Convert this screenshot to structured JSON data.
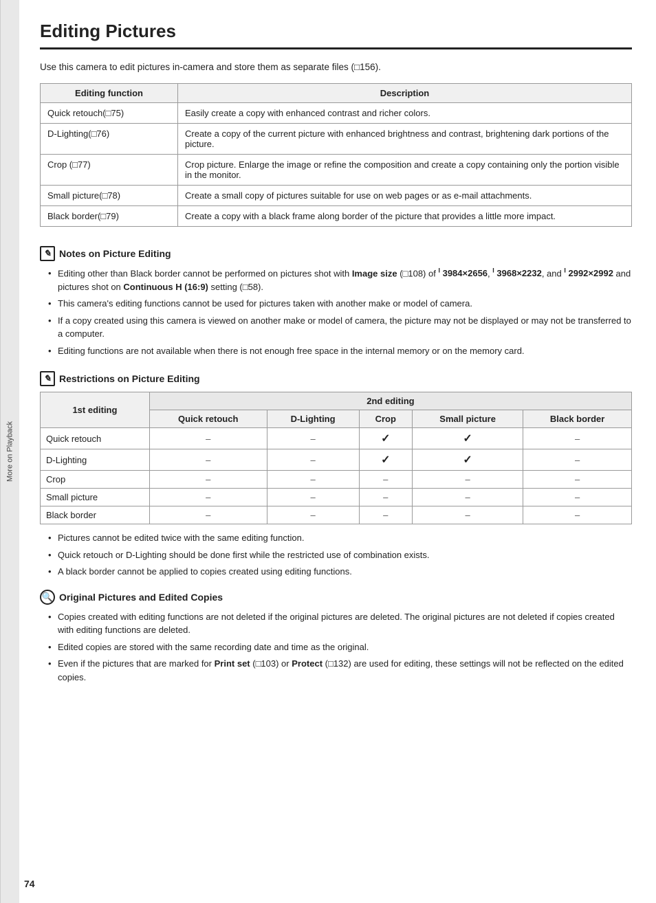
{
  "sidebar": {
    "label": "More on Playback"
  },
  "page": {
    "title": "Editing Pictures",
    "intro": "Use this camera to edit pictures in-camera and store them as separate files (◻156).",
    "page_number": "74"
  },
  "editing_table": {
    "headers": [
      "Editing function",
      "Description"
    ],
    "rows": [
      {
        "function": "Quick retouch(◻75)",
        "description": "Easily create a copy with enhanced contrast and richer colors."
      },
      {
        "function": "D-Lighting(◻76)",
        "description": "Create a copy of the current picture with enhanced brightness and contrast, brightening dark portions of the picture."
      },
      {
        "function": "Crop (◻77)",
        "description": "Crop picture. Enlarge the image or refine the composition and create a copy containing only the portion visible in the monitor."
      },
      {
        "function": "Small picture(◻78)",
        "description": "Create a small copy of pictures suitable for use on web pages or as e-mail attachments."
      },
      {
        "function": "Black border(◻79)",
        "description": "Create a copy with a black frame along border of the picture that provides a little more impact."
      }
    ]
  },
  "notes_section": {
    "icon": "✎",
    "title": "Notes on Picture Editing",
    "bullets": [
      "Editing other than Black border cannot be performed on pictures shot with Image size (◻108) of 3984×2656, 3968×2232, and 2992×2992 and pictures shot on Continuous H (16:9) setting (◻58).",
      "This camera's editing functions cannot be used for pictures taken with another make or model of camera.",
      "If a copy created using this camera is viewed on another make or model of camera, the picture may not be displayed or may not be transferred to a computer.",
      "Editing functions are not available when there is not enough free space in the internal memory or on the memory card."
    ]
  },
  "restrictions_section": {
    "icon": "✎",
    "title": "Restrictions on Picture Editing",
    "table": {
      "col_header_span": "2nd editing",
      "col_headers": [
        "1st editing",
        "Quick retouch",
        "D-Lighting",
        "Crop",
        "Small picture",
        "Black border"
      ],
      "rows": [
        {
          "label": "Quick retouch",
          "values": [
            "–",
            "–",
            "✓",
            "✓",
            "–"
          ]
        },
        {
          "label": "D-Lighting",
          "values": [
            "–",
            "–",
            "✓",
            "✓",
            "–"
          ]
        },
        {
          "label": "Crop",
          "values": [
            "–",
            "–",
            "–",
            "–",
            "–"
          ]
        },
        {
          "label": "Small picture",
          "values": [
            "–",
            "–",
            "–",
            "–",
            "–"
          ]
        },
        {
          "label": "Black border",
          "values": [
            "–",
            "–",
            "–",
            "–",
            "–"
          ]
        }
      ]
    },
    "bullets": [
      "Pictures cannot be edited twice with the same editing function.",
      "Quick retouch or D-Lighting should be done first while the restricted use of combination exists.",
      "A black border cannot be applied to copies created using editing functions."
    ]
  },
  "original_section": {
    "icon": "🔍",
    "title": "Original Pictures and Edited Copies",
    "bullets": [
      "Copies created with editing functions are not deleted if the original pictures are deleted. The original pictures are not deleted if copies created with editing functions are deleted.",
      "Edited copies are stored with the same recording date and time as the original.",
      "Even if the pictures that are marked for Print set (◻103) or Protect (◻132) are used for editing, these settings will not be reflected on the edited copies."
    ]
  }
}
